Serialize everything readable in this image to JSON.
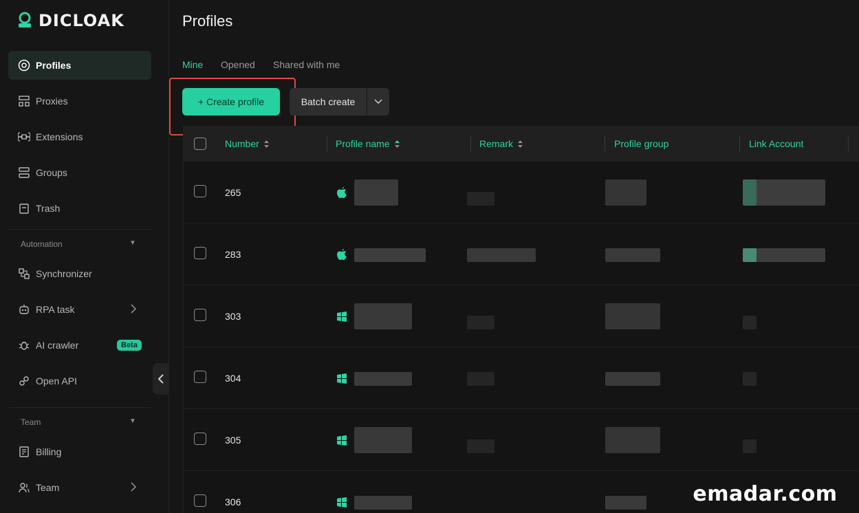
{
  "app": {
    "name": "DICLOAK"
  },
  "colors": {
    "accent": "#27d0a0",
    "highlight": "#e0493f",
    "background": "#161616"
  },
  "sidebar": {
    "items": [
      {
        "label": "Profiles",
        "icon": "profiles-icon"
      },
      {
        "label": "Proxies",
        "icon": "proxies-icon"
      },
      {
        "label": "Extensions",
        "icon": "extensions-icon"
      },
      {
        "label": "Groups",
        "icon": "groups-icon"
      },
      {
        "label": "Trash",
        "icon": "trash-icon"
      }
    ],
    "automation_label": "Automation",
    "automation_items": [
      {
        "label": "Synchronizer",
        "icon": "synchronizer-icon"
      },
      {
        "label": "RPA task",
        "icon": "rpa-icon"
      },
      {
        "label": "AI crawler",
        "icon": "ai-crawler-icon",
        "badge": "Beta"
      },
      {
        "label": "Open API",
        "icon": "open-api-icon"
      }
    ],
    "team_label": "Team",
    "team_items": [
      {
        "label": "Billing",
        "icon": "billing-icon"
      },
      {
        "label": "Team",
        "icon": "team-icon"
      }
    ]
  },
  "main": {
    "title": "Profiles",
    "tabs": [
      "Mine",
      "Opened",
      "Shared with me"
    ],
    "create_label": "+ Create profile",
    "batch_label": "Batch create",
    "columns": [
      "Number",
      "Profile name",
      "Remark",
      "Profile group",
      "Link Account"
    ],
    "rows": [
      {
        "number": "265",
        "os": "apple-icon"
      },
      {
        "number": "283",
        "os": "apple-icon"
      },
      {
        "number": "303",
        "os": "windows-icon"
      },
      {
        "number": "304",
        "os": "windows-icon"
      },
      {
        "number": "305",
        "os": "windows-icon"
      },
      {
        "number": "306",
        "os": "windows-icon"
      }
    ]
  },
  "watermark": "emadar.com"
}
